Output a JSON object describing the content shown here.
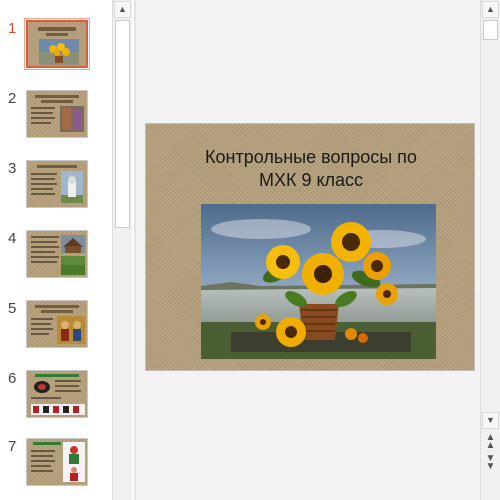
{
  "thumbnails": [
    {
      "number": "1",
      "active": true
    },
    {
      "number": "2",
      "active": false
    },
    {
      "number": "3",
      "active": false
    },
    {
      "number": "4",
      "active": false
    },
    {
      "number": "5",
      "active": false
    },
    {
      "number": "6",
      "active": false
    },
    {
      "number": "7",
      "active": false
    }
  ],
  "slide": {
    "title_line1": "Контрольные вопросы по",
    "title_line2": "МХК 9 класс",
    "image": "sunflowers-in-basket-photo"
  },
  "scroll": {
    "up_icon": "triangle-up-icon",
    "down_icon": "triangle-down-icon",
    "prev_slide_icon": "double-chevron-up-icon",
    "next_slide_icon": "double-chevron-down-icon"
  },
  "colors": {
    "active_number": "#c5532c",
    "selected_border": "#e05a3a",
    "burlap": "#b8a37f"
  }
}
